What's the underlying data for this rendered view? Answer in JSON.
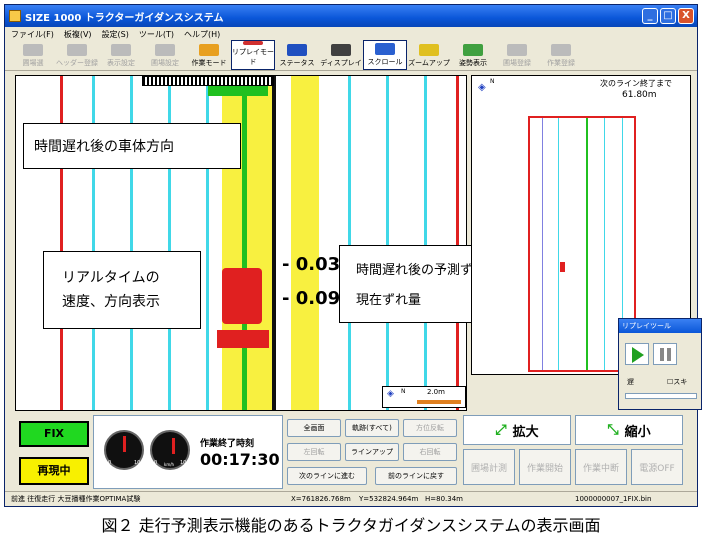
{
  "window": {
    "title": "SIZE 1000  トラクターガイダンスシステム",
    "min": "_",
    "max": "□",
    "close": "X"
  },
  "menu": [
    "ファイル(F)",
    "板複(V)",
    "設定(S)",
    "ツール(T)",
    "ヘルプ(H)"
  ],
  "toolbar": [
    {
      "label": "圃場選",
      "enabled": false
    },
    {
      "label": "ヘッダー登録",
      "enabled": false
    },
    {
      "label": "表示設定",
      "enabled": false
    },
    {
      "label": "圃場設定",
      "enabled": false
    },
    {
      "label": "作業モード",
      "enabled": true
    },
    {
      "label": "リプレイモード",
      "enabled": true
    },
    {
      "label": "ステータス",
      "enabled": true
    },
    {
      "label": "ディスプレイ",
      "enabled": true
    },
    {
      "label": "スクロール",
      "enabled": true
    },
    {
      "label": "ズームアップ",
      "enabled": true
    },
    {
      "label": "姿勢表示",
      "enabled": true
    },
    {
      "label": "圃場登録",
      "enabled": false
    },
    {
      "label": "作業登録",
      "enabled": false
    }
  ],
  "main": {
    "deviation1": "- 0.03m",
    "deviation2": "- 0.09m",
    "scale": "2.0m",
    "north": "N",
    "annotations": {
      "heading": "時間遅れ後の車体方向",
      "realtime1": "リアルタイムの",
      "realtime2": "速度、方向表示",
      "predicted": "時間遅れ後の予測ずれ量",
      "current": "現在ずれ量"
    }
  },
  "minimap": {
    "label": "次のライン終了まで",
    "distance": "61.80m",
    "north": "N"
  },
  "bottom": {
    "fix": "FIX",
    "replaying": "再現中",
    "gauge1_ticks": [
      "0",
      "10"
    ],
    "gauge2_ticks": [
      "0",
      "10"
    ],
    "speed_unit": "km/h",
    "work_end_label": "作業終了時刻",
    "work_end_time": "00:17:30",
    "buttons": [
      {
        "label": "全画面",
        "enabled": true
      },
      {
        "label": "軌跡(すべて)",
        "enabled": true
      },
      {
        "label": "方位反転",
        "enabled": false
      },
      {
        "label": "左回転",
        "enabled": false
      },
      {
        "label": "ラインアップ",
        "enabled": true
      },
      {
        "label": "右回転",
        "enabled": false
      },
      {
        "label": "次のラインに進む",
        "enabled": true
      },
      {
        "label": "前のラインに戻す",
        "enabled": true
      }
    ],
    "zoom_in": "拡大",
    "zoom_out": "縮小",
    "actions": [
      "圃場計測",
      "作業開始",
      "作業中断",
      "電源OFF"
    ]
  },
  "replay": {
    "title": "リプレイツール",
    "speed_label": "遅",
    "check_label": "スキ"
  },
  "status": {
    "left": "前進  往復走行  大豆播種作業OPTIMA試験",
    "x": "X=761826.768m",
    "y": "Y=532824.964m",
    "h": "H=80.34m",
    "file": "1000000007_1FIX.bin"
  },
  "caption": "図２  走行予測表示機能のあるトラクタガイダンスシステムの表示画面"
}
